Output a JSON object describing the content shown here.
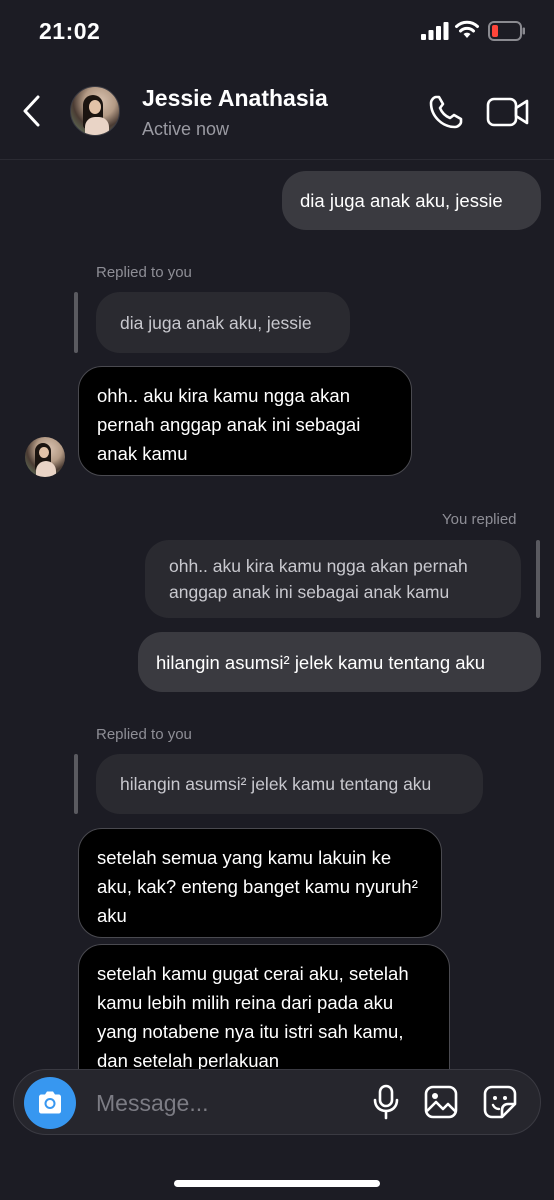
{
  "status_bar": {
    "time": "21:02"
  },
  "header": {
    "contact_name": "Jessie Anathasia",
    "contact_status": "Active now",
    "back_icon": "chevron-left-icon",
    "call_icon": "phone-icon",
    "video_icon": "video-camera-icon"
  },
  "messages": [
    {
      "type": "outgoing",
      "text": "dia juga anak aku, jessie"
    },
    {
      "type": "reply-label",
      "text": "Replied to you"
    },
    {
      "type": "quote",
      "text": "dia juga anak aku, jessie"
    },
    {
      "type": "incoming",
      "text": "ohh.. aku kira kamu ngga akan pernah anggap anak ini sebagai anak kamu"
    },
    {
      "type": "reply-label",
      "text": "You replied"
    },
    {
      "type": "quote",
      "text": "ohh.. aku kira kamu ngga akan pernah anggap anak ini sebagai anak kamu"
    },
    {
      "type": "outgoing",
      "text": "hilangin asumsi² jelek kamu tentang aku"
    },
    {
      "type": "reply-label",
      "text": "Replied to you"
    },
    {
      "type": "quote",
      "text": "hilangin asumsi² jelek kamu tentang aku"
    },
    {
      "type": "incoming",
      "text": "setelah semua yang kamu lakuin ke aku, kak? enteng banget kamu nyuruh² aku"
    },
    {
      "type": "incoming",
      "text": "setelah kamu gugat cerai aku, setelah kamu lebih milih reina dari pada aku yang notabene nya itu istri sah kamu, dan setelah perlakuan"
    }
  ],
  "composer": {
    "placeholder": "Message...",
    "camera_icon": "camera-icon",
    "mic_icon": "microphone-icon",
    "gallery_icon": "image-icon",
    "sticker_icon": "sticker-icon"
  },
  "colors": {
    "background": "#1c1c24",
    "outgoing_bubble": "#3a3a40",
    "incoming_bubble": "#000000",
    "accent": "#3797f0",
    "battery_low": "#ff453a"
  }
}
